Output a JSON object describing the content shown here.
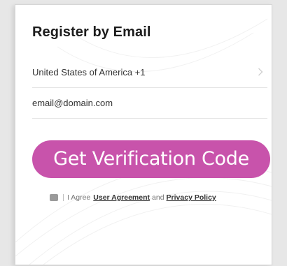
{
  "form": {
    "title": "Register by Email",
    "country_value": "United States of America +1",
    "email_placeholder": "email@domain.com",
    "button_label": "Get Verification Code",
    "agree_prefix": "I Agree",
    "user_agreement_label": "User Agreement",
    "and_label": "and",
    "privacy_policy_label": "Privacy Policy"
  },
  "icons": {
    "chevron": "chevron-right-icon",
    "checkbox": "checkbox-icon"
  },
  "colors": {
    "accent": "#c853ab",
    "checkbox": "#9a9a9a"
  }
}
